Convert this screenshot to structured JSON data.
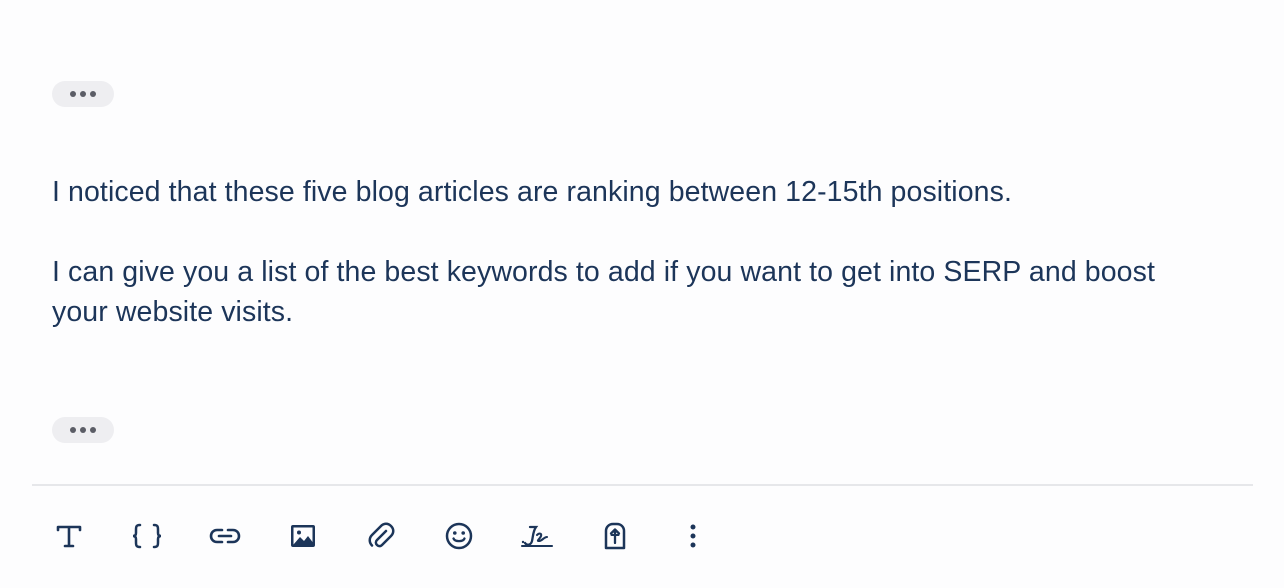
{
  "message": {
    "paragraphs": [
      "I noticed that these five blog articles are ranking between 12-15th positions.",
      "I can give you a list of the best keywords to add if you want to get into SERP and boost your website visits."
    ]
  },
  "toolbar": {
    "items": [
      {
        "icon": "text-format-icon"
      },
      {
        "icon": "variables-braces-icon"
      },
      {
        "icon": "link-icon"
      },
      {
        "icon": "image-icon"
      },
      {
        "icon": "attachment-icon"
      },
      {
        "icon": "emoji-icon"
      },
      {
        "icon": "signature-icon"
      },
      {
        "icon": "template-icon"
      },
      {
        "icon": "more-vertical-icon"
      }
    ]
  },
  "colors": {
    "text": "#1c3559",
    "pill_background": "#eeeef1",
    "pill_dots": "#5b5d66",
    "divider": "#e6e7ea",
    "background": "#fdfdfe"
  }
}
